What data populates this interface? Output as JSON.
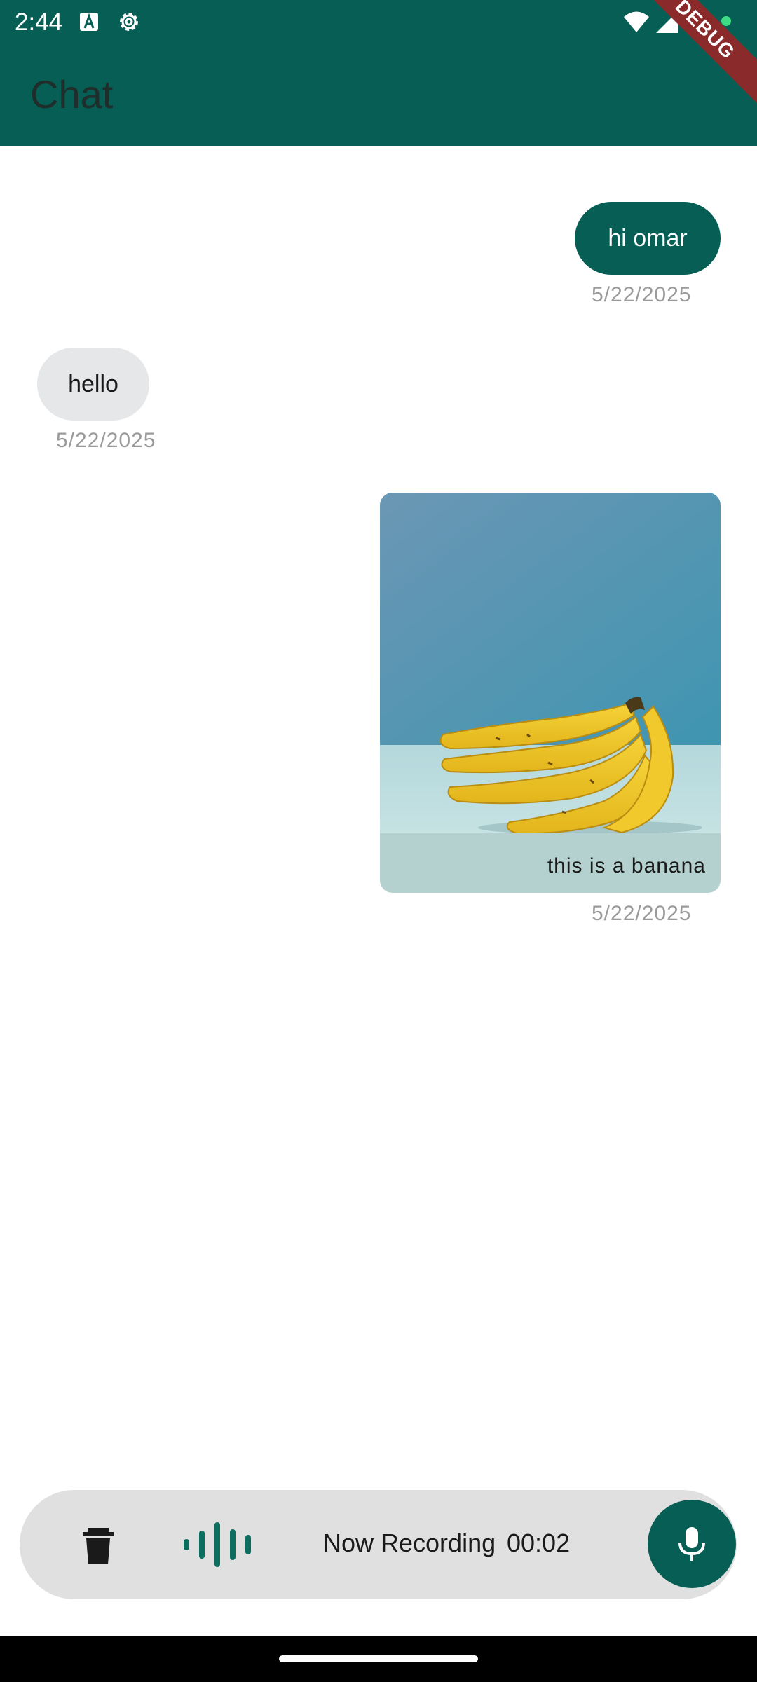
{
  "status_bar": {
    "time": "2:44",
    "icons": [
      "text-a-icon",
      "settings-icon",
      "wifi-icon",
      "signal-icon",
      "battery-icon",
      "notification-dot"
    ]
  },
  "app_bar": {
    "title": "Chat",
    "debug_label": "DEBUG",
    "color": "#075e54"
  },
  "messages": [
    {
      "direction": "sent",
      "type": "text",
      "text": "hi omar",
      "date": "5/22/2025"
    },
    {
      "direction": "received",
      "type": "text",
      "text": "hello",
      "date": "5/22/2025"
    },
    {
      "direction": "sent",
      "type": "image",
      "caption": "this is a banana",
      "date": "5/22/2025"
    }
  ],
  "recording_bar": {
    "status": "Now Recording",
    "timer": "00:02",
    "icons": [
      "trash-icon",
      "waveform-icon",
      "mic-icon"
    ]
  },
  "colors": {
    "accent": "#075e54",
    "received_bubble": "#e6e7e8",
    "timestamp": "#9a9a9a",
    "record_bar": "#e0e0e0"
  }
}
